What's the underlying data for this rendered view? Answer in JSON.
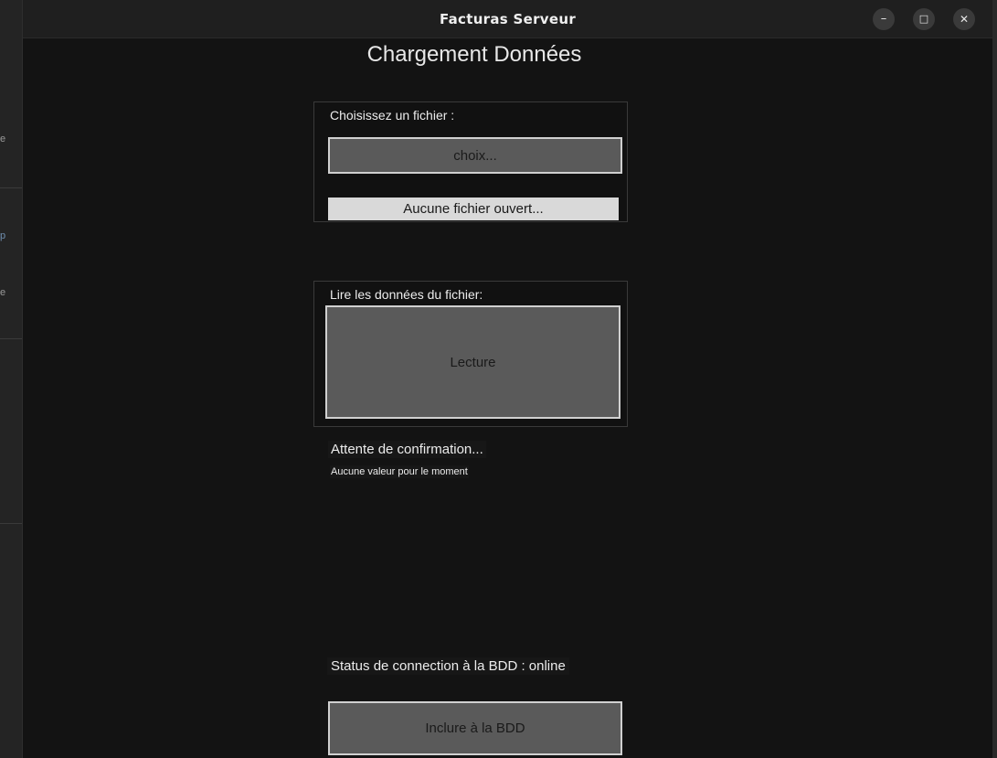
{
  "window": {
    "title": "Facturas Serveur",
    "controls": {
      "minimize": "–",
      "maximize": "□",
      "close": "✕"
    }
  },
  "background_fragments": [
    "e",
    "p",
    "e"
  ],
  "page": {
    "heading": "Chargement Données"
  },
  "file_section": {
    "label": "Choisissez un fichier :",
    "choose_button": "choix...",
    "file_status": "Aucune fichier ouvert..."
  },
  "read_section": {
    "label": "Lire les données du fichier:",
    "read_button": "Lecture"
  },
  "confirmation": {
    "title": "Attente de confirmation...",
    "detail": "Aucune valeur pour le moment"
  },
  "database": {
    "status": "Status de connection à la BDD : online",
    "include_button": "Inclure à la BDD"
  }
}
